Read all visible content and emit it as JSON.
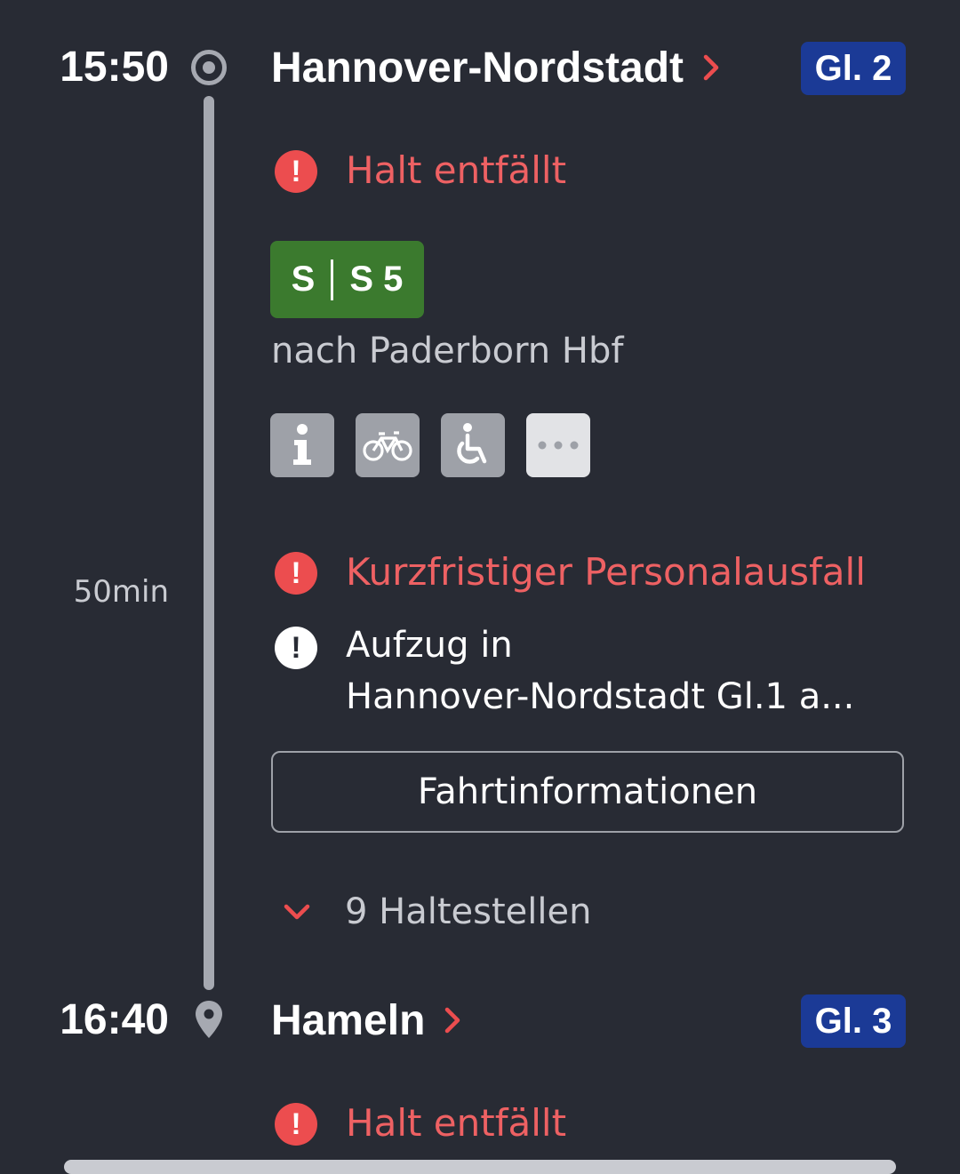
{
  "origin": {
    "time": "15:50",
    "station": "Hannover-Nordstadt",
    "platform": "Gl. 2"
  },
  "alerts_top": {
    "stop_cancelled": "Halt entfällt"
  },
  "train": {
    "product": "S",
    "line": "S 5",
    "destination": "nach Paderborn Hbf",
    "features": [
      "info-icon",
      "bicycle-icon",
      "wheelchair-icon",
      "more-icon"
    ]
  },
  "duration": "50min",
  "messages": {
    "staff_shortage": "Kurzfristiger Personalausfall",
    "elevator_line1": "Aufzug in",
    "elevator_line2": "Hannover-Nordstadt Gl.1 a..."
  },
  "trip_info_button": "Fahrtinformationen",
  "stops_toggle": "9 Haltestellen",
  "destination_stop": {
    "time": "16:40",
    "station": "Hameln",
    "platform": "Gl. 3",
    "alert": "Halt entfällt"
  },
  "colors": {
    "background": "#282b34",
    "alert_red": "#ec4d4f",
    "platform_blue": "#1b3a96",
    "s_bahn_green": "#3b7a2e"
  }
}
